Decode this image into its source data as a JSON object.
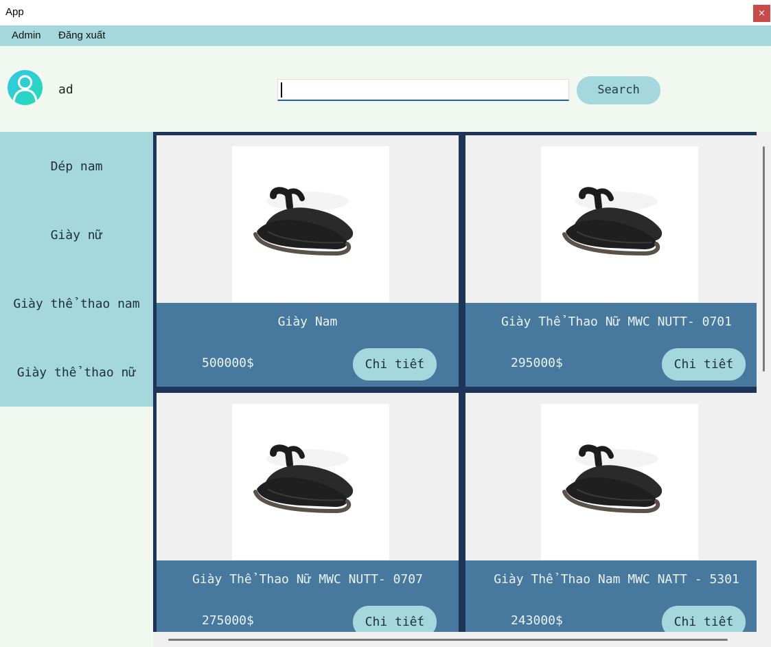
{
  "window": {
    "title": "App",
    "close_glyph": "×"
  },
  "menu": {
    "items": [
      "Admin",
      "Đăng xuất"
    ]
  },
  "header": {
    "avatar_icon": "user-avatar-icon",
    "username": "ad",
    "search": {
      "value": "",
      "placeholder": ""
    },
    "search_button": "Search"
  },
  "sidebar": {
    "categories": [
      "Dép nam",
      "Giày nữ",
      "Giày thể thao nam",
      "Giày thể thao nữ"
    ]
  },
  "products": [
    {
      "name": "Giày Nam",
      "price": "500000$",
      "button": "Chi tiết"
    },
    {
      "name": "Giày Thể Thao Nữ MWC NUTT- 0701",
      "price": "295000$",
      "button": "Chi tiết"
    },
    {
      "name": "Giày Thể Thao Nữ MWC NUTT- 0707",
      "price": "275000$",
      "button": "Chi tiết"
    },
    {
      "name": "Giày Thể Thao Nam MWC NATT - 5301",
      "price": "243000$",
      "button": "Chi tiết"
    }
  ],
  "colors": {
    "menubar": "#a5d8dc",
    "header_bg": "#f0f8ef",
    "grid_bg": "#1e3459",
    "card_info": "#46799d",
    "button": "#a5d8dc",
    "close": "#c94a4a"
  }
}
